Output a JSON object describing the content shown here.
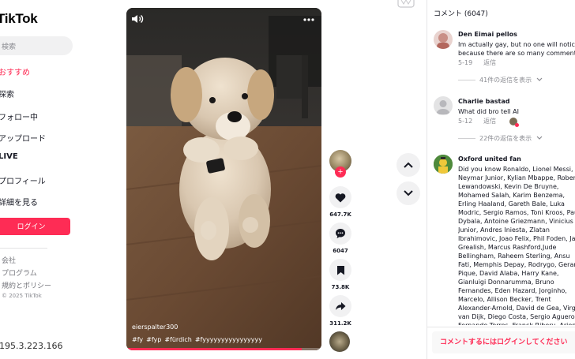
{
  "sidebar": {
    "logo": "TikTok",
    "search_placeholder": "検索",
    "nav": [
      "おすすめ",
      "探索",
      "フォロー中",
      "アップロード",
      "LIVE",
      "プロフィール",
      "詳細を見る"
    ],
    "login_label": "ログイン",
    "footer_links": [
      "会社",
      "プログラム",
      "規約とポリシー"
    ],
    "copyright": "© 2025 TikTok"
  },
  "ip_text": "195.3.223.166",
  "video": {
    "author": "eierspalter300",
    "hashtags": [
      "#fy",
      "#fyp",
      "#fürdich",
      "#fyyyyyyyyyyyyyyyy"
    ],
    "progress_fraction": 0.9
  },
  "actions": {
    "likes": "647.7K",
    "comments": "6047",
    "saves": "73.8K",
    "shares": "311.2K"
  },
  "comments_panel": {
    "header": "コメント (6047)",
    "items": [
      {
        "name": "Den Eimai pellos",
        "text": "Im actually gay, but no one will notice because there are so many comments.",
        "date": "5-19",
        "reply_label": "返信",
        "replies": "41件の返信を表示"
      },
      {
        "name": "Charlie bastad",
        "text": "What did bro tell AI",
        "date": "5-12",
        "reply_label": "返信",
        "replies": "22件の返信を表示"
      },
      {
        "name": "Oxford united fan",
        "text": "Did you know Ronaldo, Lionel Messi, Neymar Junior, Kylian Mbappe, Robert Lewandowski, Kevin De Bruyne, Mohamed Salah, Karim Benzema, Erling Haaland, Gareth Bale, Luka Modric, Sergio Ramos, Toni Kroos, Paulo Dybala, Antoine Griezmann, Vinicius Junior, Andres Iniesta, Zlatan Ibrahimovic, Joao Felix, Phil Foden, Jack Grealish, Marcus Rashford,Jude Bellingham, Raheem Sterling, Ansu Fati, Memphis Depay, Rodrygo, Gerard Pique, David Alaba, Harry Kane, Gianluigi Donnarumma, Bruno Fernandes, Eden Hazard, Jorginho, Marcelo, Allison Becker, Trent Alexander-Arnold, David de Gea, Virgil van Dijk, Diego Costa, Sergio Aguero, Fernando Torres, Franck Ribery, Arjen Robben, David Villa, Koke, Mats Hummels, Pierre-Emerick Aubameyang, Xabi Alonso, Danny Alves, Alves, Keylor Navas, Casemiro, Eder Militao"
      }
    ],
    "login_prompt": "コメントするにはログインしてください"
  }
}
